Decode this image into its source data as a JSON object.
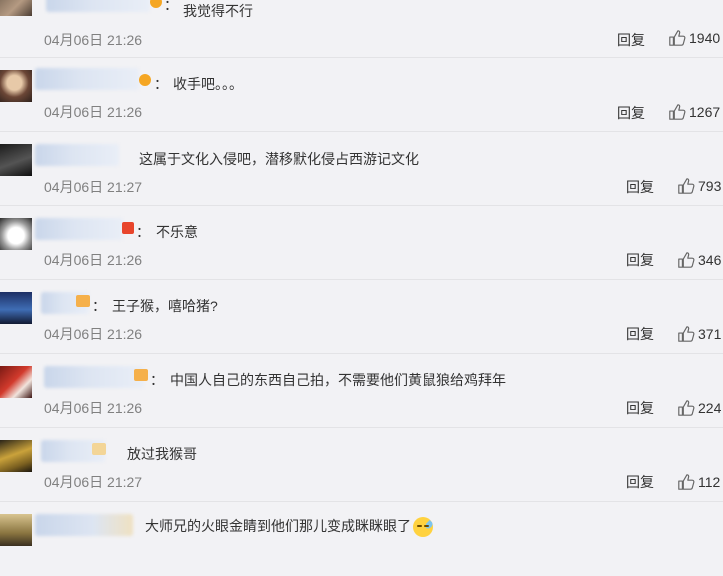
{
  "comments": [
    {
      "text": "我觉得不行",
      "time": "04月06日 21:26",
      "reply": "回复",
      "likes": "1940",
      "badge": "#f5a623"
    },
    {
      "text": "收手吧。。。",
      "time": "04月06日 21:26",
      "reply": "回复",
      "likes": "1267",
      "badge": "#f5a623"
    },
    {
      "text": "这属于文化入侵吧，潜移默化侵占西游记文化",
      "time": "04月06日 21:27",
      "reply": "回复",
      "likes": "793"
    },
    {
      "text": "不乐意",
      "time": "04月06日 21:26",
      "reply": "回复",
      "likes": "346",
      "badge": "#e8452c"
    },
    {
      "text": "王子猴，嘻哈猪?",
      "time": "04月06日 21:26",
      "reply": "回复",
      "likes": "371",
      "badge": "#f5b04b"
    },
    {
      "text": "中国人自己的东西自己拍，不需要他们黄鼠狼给鸡拜年",
      "time": "04月06日 21:26",
      "reply": "回复",
      "likes": "224",
      "badge": "#f5b04b"
    },
    {
      "text": "放过我猴哥",
      "time": "04月06日 21:27",
      "reply": "回复",
      "likes": "112",
      "badge": "#f3d597"
    },
    {
      "text": "大师兄的火眼金睛到他们那儿变成眯眯眼了",
      "time": "",
      "reply": "",
      "likes": "",
      "emoji": "sweat-face-emoji"
    }
  ],
  "colon": "：",
  "icons": {
    "like": "thumbs-up-icon",
    "avatar": "user-avatar-icon"
  },
  "colors": {
    "background": "#f2f2f5",
    "text": "#333333",
    "time": "#808080",
    "divider": "#e3e3e6"
  }
}
